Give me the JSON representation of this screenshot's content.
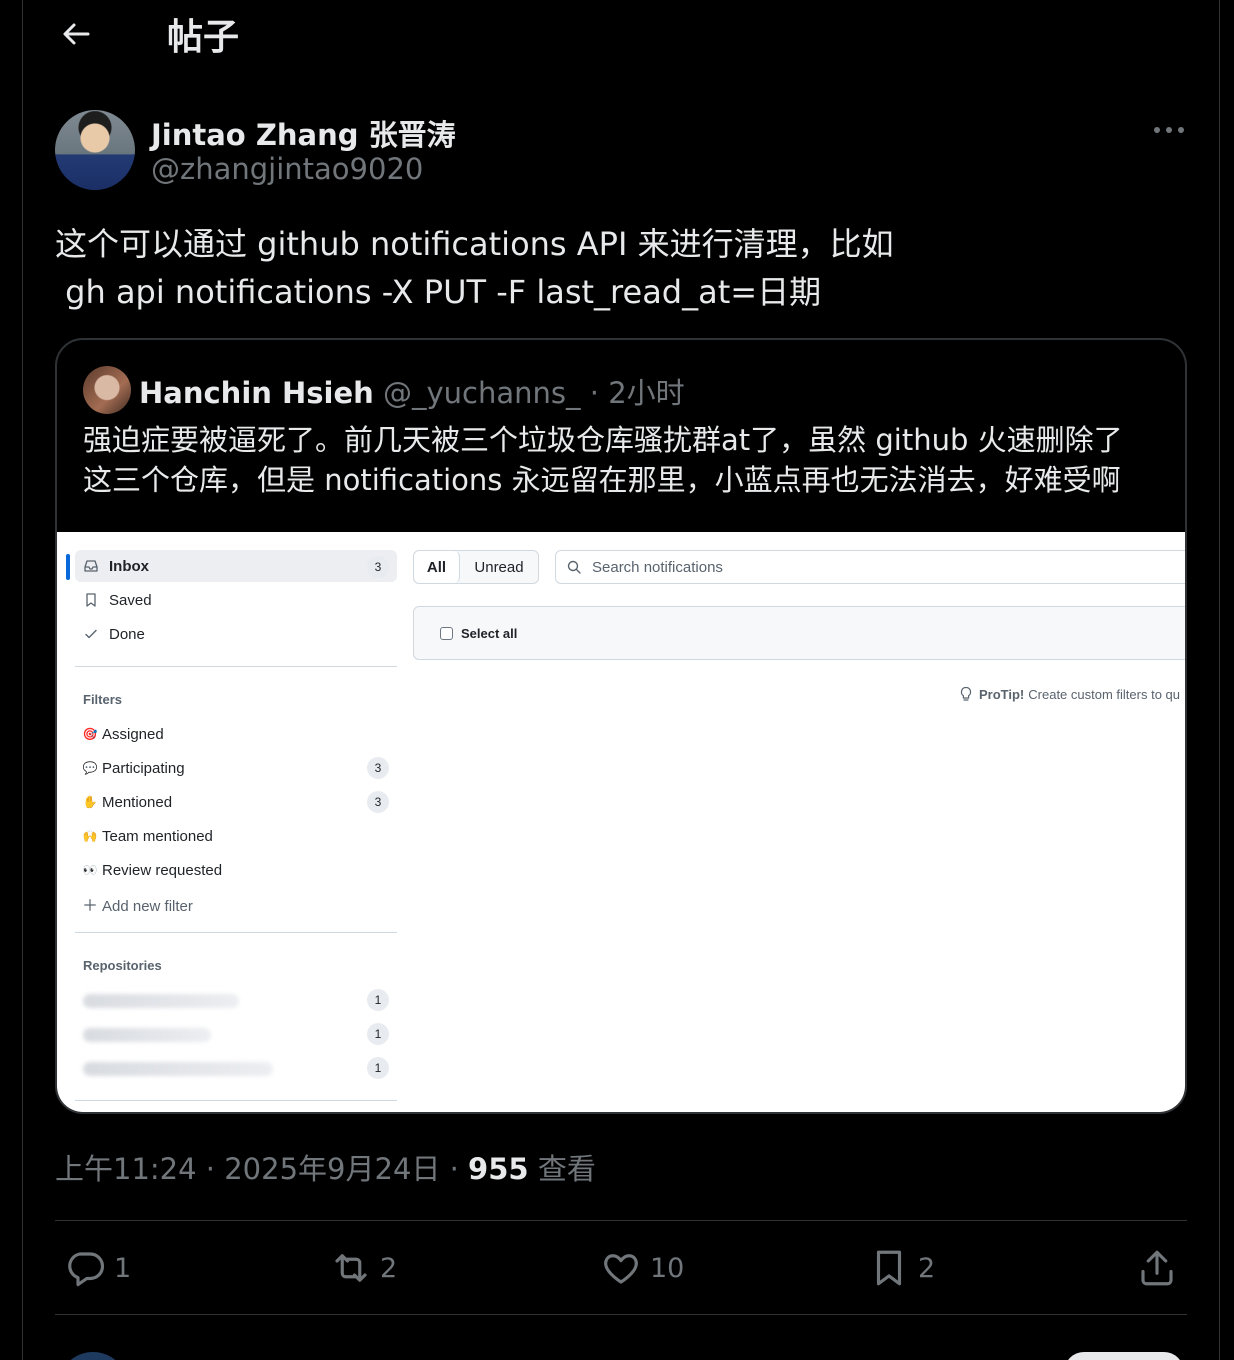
{
  "header": {
    "title": "帖子",
    "back_icon": "arrow-left-icon"
  },
  "author": {
    "name": "Jintao Zhang 张晋涛",
    "handle": "@zhangjintao9020"
  },
  "post": {
    "lines": [
      "这个可以通过 github notifications API 来进行清理，比如",
      " gh api notifications -X PUT -F last_read_at=日期"
    ]
  },
  "quote": {
    "name": "Hanchin Hsieh",
    "handle": "@_yuchanns_",
    "separator": "·",
    "time": "2小时",
    "lines": [
      "强迫症要被逼死了。前几天被三个垃圾仓库骚扰群at了，虽然 github 火速删除了",
      "这三个仓库，但是 notifications 永远留在那里，小蓝点再也无法消去，好难受啊"
    ],
    "image": {
      "sidebar": {
        "inbox": {
          "label": "Inbox",
          "count": "3"
        },
        "saved": "Saved",
        "done": "Done",
        "filters_title": "Filters",
        "filters": [
          {
            "label": "Assigned",
            "emoji": "🎯",
            "count": ""
          },
          {
            "label": "Participating",
            "emoji": "💬",
            "count": "3"
          },
          {
            "label": "Mentioned",
            "emoji": "✋",
            "count": "3"
          },
          {
            "label": "Team mentioned",
            "emoji": "🙌",
            "count": ""
          },
          {
            "label": "Review requested",
            "emoji": "👀",
            "count": ""
          }
        ],
        "add_filter": "Add new filter",
        "repos_title": "Repositories",
        "repo_counts": [
          "1",
          "1",
          "1"
        ]
      },
      "tabs": {
        "all": "All",
        "unread": "Unread"
      },
      "search_placeholder": "Search notifications",
      "select_all": "Select all",
      "protip_label": "ProTip!",
      "protip_text": "Create custom filters to qu"
    }
  },
  "meta": {
    "time": "上午11:24",
    "dot1": "·",
    "date": "2025年9月24日",
    "dot2": "·",
    "views": "955",
    "views_label": "查看"
  },
  "actions": {
    "replies": "1",
    "reposts": "2",
    "likes": "10",
    "bookmarks": "2"
  },
  "colors": {
    "background": "#000000",
    "text": "#e7e9ea",
    "muted": "#71767b",
    "border": "#2f3336",
    "github_accent": "#0969da"
  }
}
